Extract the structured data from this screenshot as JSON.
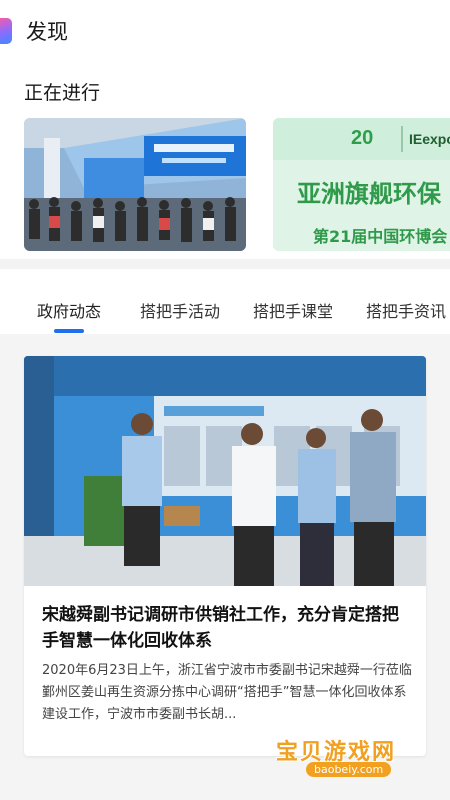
{
  "header": {
    "title": "发现"
  },
  "section": {
    "title": "正在进行"
  },
  "carousel": {
    "cards": [
      {
        "kind": "exhibition-photo"
      },
      {
        "logo_text": "IEexpo",
        "big_text": "亚洲旗舰环保",
        "sub_text": "第21届中国环博会"
      }
    ]
  },
  "tabs": [
    {
      "label": "政府动态",
      "active": true
    },
    {
      "label": "搭把手活动",
      "active": false
    },
    {
      "label": "搭把手课堂",
      "active": false
    },
    {
      "label": "搭把手资讯",
      "active": false
    }
  ],
  "news": [
    {
      "title": "宋越舜副书记调研市供销社工作，充分肯定搭把手智慧一体化回收体系",
      "summary": "2020年6月23日上午，浙江省宁波市市委副书记宋越舜一行莅临鄞州区姜山再生资源分拣中心调研“搭把手”智慧一体化回收体系建设工作，宁波市市委副书长胡..."
    }
  ],
  "watermark": {
    "text": "宝贝游戏网",
    "url": "baobeiy.com"
  },
  "colors": {
    "accent": "#1e6ff0",
    "feed_bg": "#f4f4f4"
  }
}
